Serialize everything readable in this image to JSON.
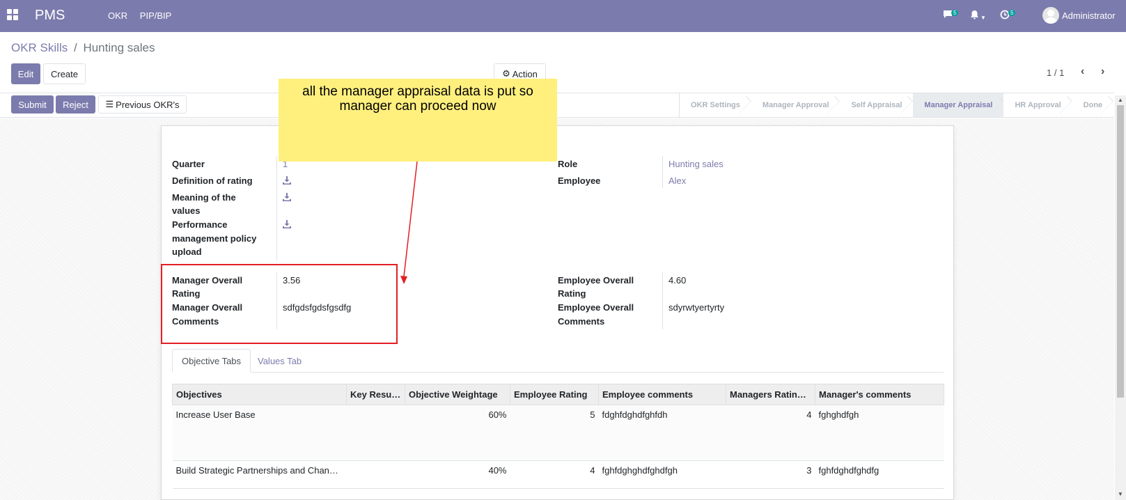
{
  "navbar": {
    "brand": "PMS",
    "menu": [
      "OKR",
      "PIP/BIP"
    ],
    "chat_count": "5",
    "activity_count": "5",
    "user": "Administrator"
  },
  "breadcrumb": {
    "parent": "OKR Skills",
    "separator": "/",
    "current": "Hunting sales"
  },
  "buttons": {
    "edit": "Edit",
    "create": "Create",
    "action": "Action",
    "submit": "Submit",
    "reject": "Reject",
    "previous": "Previous OKR's"
  },
  "pager": {
    "value": "1 / 1"
  },
  "stages": [
    "OKR Settings",
    "Manager Approval",
    "Self Appraisal",
    "Manager Appraisal",
    "HR Approval",
    "Done"
  ],
  "active_stage": "Manager Appraisal",
  "form": {
    "quarter_label": "Quarter",
    "quarter_value": "1",
    "definition_label": "Definition of rating",
    "meaning_label_1": "Meaning of the",
    "meaning_label_2": "values",
    "policy_label_1": "Performance",
    "policy_label_2": "management policy",
    "policy_label_3": "upload",
    "role_label": "Role",
    "role_value": "Hunting sales",
    "employee_label": "Employee",
    "employee_value": "Alex",
    "mgr_rating_label_1": "Manager Overall",
    "mgr_rating_label_2": "Rating",
    "mgr_rating_value": "3.56",
    "mgr_comments_label_1": "Manager Overall",
    "mgr_comments_label_2": "Comments",
    "mgr_comments_value": "sdfgdsfgdsfgsdfg",
    "emp_rating_label_1": "Employee Overall",
    "emp_rating_label_2": "Rating",
    "emp_rating_value": "4.60",
    "emp_comments_label_1": "Employee Overall",
    "emp_comments_label_2": "Comments",
    "emp_comments_value": "sdyrwtyertyrty"
  },
  "tabs": [
    "Objective Tabs",
    "Values Tab"
  ],
  "table": {
    "headers": [
      "Objectives",
      "Key Results",
      "Objective Weightage",
      "Employee Rating",
      "Employee comments",
      "Managers Ratin…",
      "Manager's comments"
    ],
    "rows": [
      [
        "Increase User Base",
        "",
        "60%",
        "5",
        "fdghfdghdfghfdh",
        "4",
        "fghghdfgh"
      ],
      [
        "Build Strategic Partnerships and Chann…",
        "",
        "40%",
        "4",
        "fghfdghghdfghdfgh",
        "3",
        "fghfdghdfghdfg"
      ]
    ]
  },
  "annotation": {
    "line1": "all the manager appraisal data is put so",
    "line2": "manager can proceed now"
  },
  "colors": {
    "primary": "#7c7bad",
    "annotation_bg": "#fff07e",
    "highlight": "#e31e24"
  }
}
